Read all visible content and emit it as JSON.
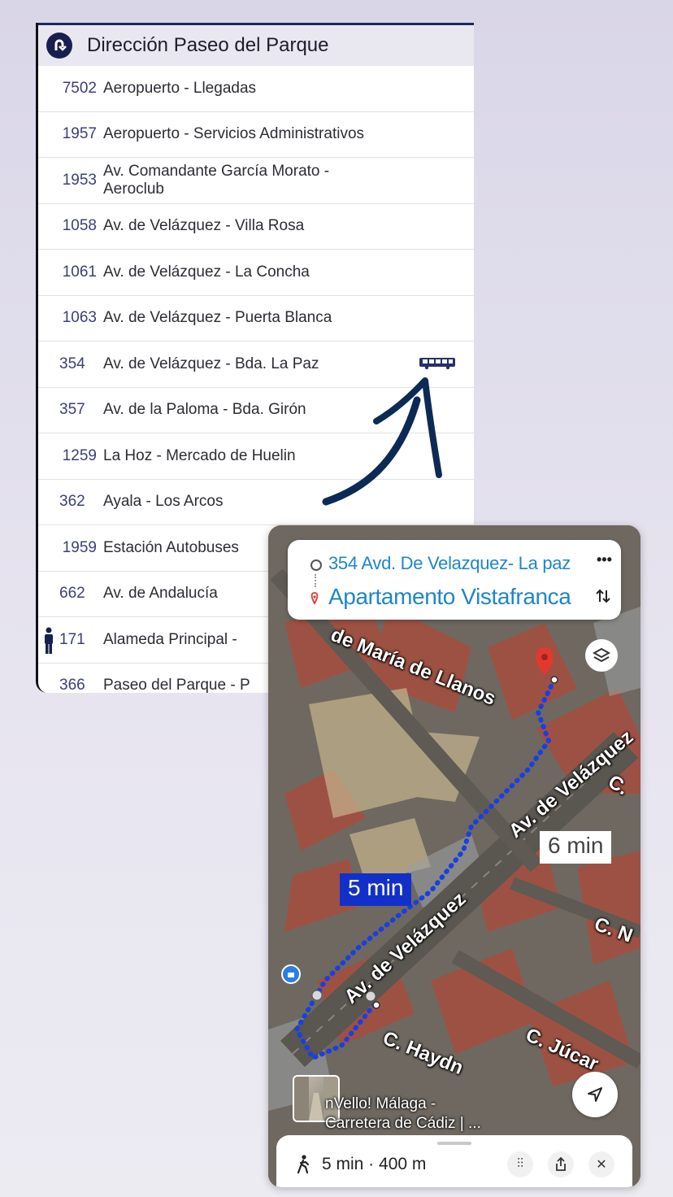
{
  "stops_panel": {
    "title": "Dirección Paseo del Parque",
    "stops": [
      {
        "code": "7502",
        "name": "Aeropuerto - Llegadas"
      },
      {
        "code": "1957",
        "name": "Aeropuerto - Servicios Administrativos"
      },
      {
        "code": "1953",
        "name": "Av. Comandante García Morato - Aeroclub"
      },
      {
        "code": "1058",
        "name": "Av. de Velázquez - Villa Rosa"
      },
      {
        "code": "1061",
        "name": "Av. de Velázquez - La Concha"
      },
      {
        "code": "1063",
        "name": "Av. de Velázquez - Puerta Blanca"
      },
      {
        "code": "354",
        "name": "Av. de Velázquez - Bda. La Paz"
      },
      {
        "code": "357",
        "name": "Av. de la Paloma - Bda. Girón"
      },
      {
        "code": "1259",
        "name": "La Hoz - Mercado  de Huelin"
      },
      {
        "code": "362",
        "name": "Ayala - Los Arcos"
      },
      {
        "code": "1959",
        "name": "Estación Autobuses"
      },
      {
        "code": "662",
        "name": "Av. de Andalucía"
      },
      {
        "code": "171",
        "name": "Alameda Principal - "
      },
      {
        "code": "366",
        "name": "Paseo del Parque - P"
      }
    ]
  },
  "map": {
    "origin": "354 Avd. De Velazquez- La paz",
    "destination": "Apartamento Vistafranca",
    "streets": {
      "maria_llanos": "de María de Llanos",
      "velazquez_upper": "Av. de Velázquez",
      "velazquez_lower": "Av. de Velázquez",
      "haydn": "C. Haydn",
      "jucar": "C. Júcar",
      "c_n": "C. N",
      "c_right": "C."
    },
    "eta_walk_route": "5 min",
    "eta_alt_route": "6 min",
    "place_line1": "nVello! Málaga -",
    "place_line2": "Carretera de Cádiz | ...",
    "summary": "5 min · 400 m"
  },
  "colors": {
    "accent_blue": "#1e86c8",
    "route_blue": "#1a3fe0",
    "nav_dark": "#17204f",
    "pin_red": "#e03a2f"
  }
}
